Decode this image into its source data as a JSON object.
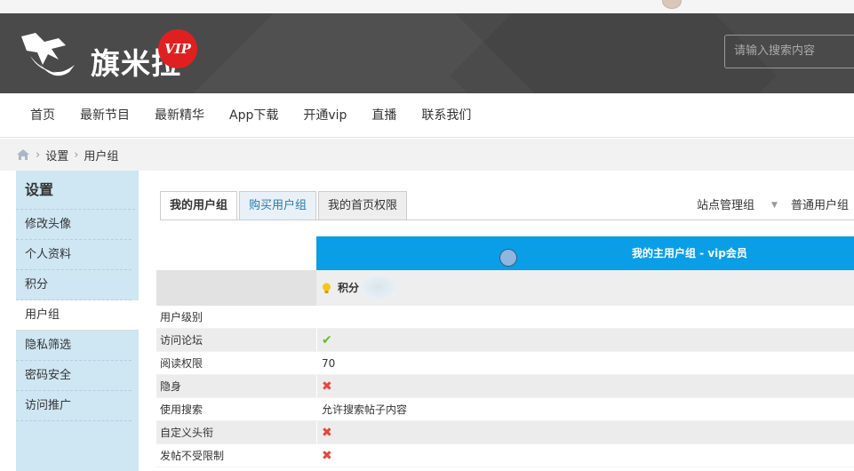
{
  "header": {
    "logo_text": "旗米拉",
    "vip_badge": "VIP",
    "search_placeholder": "请输入搜索内容"
  },
  "nav": {
    "items": [
      "首页",
      "最新节目",
      "最新精华",
      "App下载",
      "开通vip",
      "直播",
      "联系我们"
    ]
  },
  "breadcrumb": {
    "items": [
      "设置",
      "用户组"
    ]
  },
  "sidebar": {
    "title": "设置",
    "items": [
      "修改头像",
      "个人资料",
      "积分",
      "用户组",
      "隐私筛选",
      "密码安全",
      "访问推广"
    ],
    "active": "用户组"
  },
  "tabs": {
    "items": [
      "我的用户组",
      "购买用户组",
      "我的首页权限"
    ]
  },
  "right_tabs": {
    "admin": "站点管理组",
    "normal": "普通用户组"
  },
  "group": {
    "title": "我的主用户组 - vip会员",
    "points_label": "积分"
  },
  "table": {
    "rows": [
      {
        "label": "用户级别",
        "value": ""
      },
      {
        "label": "访问论坛",
        "value": "✔"
      },
      {
        "label": "阅读权限",
        "value": "70"
      },
      {
        "label": "隐身",
        "value": "✖"
      },
      {
        "label": "使用搜索",
        "value": "允许搜索帖子内容"
      },
      {
        "label": "自定义头衔",
        "value": "✖"
      },
      {
        "label": "发帖不受限制",
        "value": "✖"
      }
    ]
  },
  "colors": {
    "header_bg": "#4a4a4a",
    "group_header_bg": "#0a9ee6",
    "sidebar_bg": "#cfe6f3",
    "vip_red": "#e02020",
    "check_green": "#6aba2a",
    "cross_red": "#e8453c"
  }
}
